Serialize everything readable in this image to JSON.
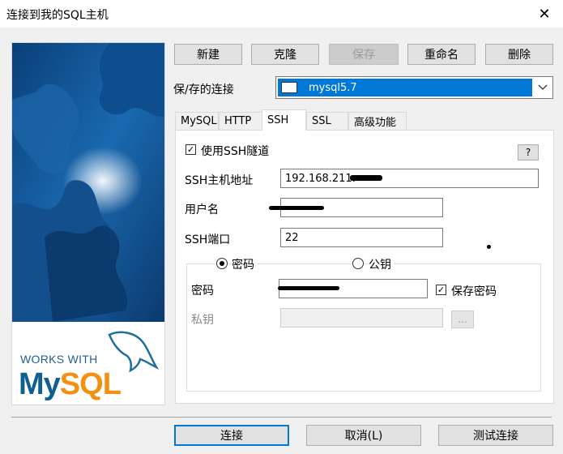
{
  "window": {
    "title": "连接到我的SQL主机"
  },
  "branding": {
    "works_with": "WORKS WITH",
    "logo_my": "My",
    "logo_sql": "SQL"
  },
  "toolbar": {
    "new_label": "新建",
    "clone_label": "克隆",
    "save_label": "保存",
    "rename_label": "重命名",
    "delete_label": "删除"
  },
  "saved_connections": {
    "label": "保/存的连接",
    "selected": "mysql5.7"
  },
  "tabs": [
    {
      "label": "MySQL"
    },
    {
      "label": "HTTP"
    },
    {
      "label": "SSH"
    },
    {
      "label": "SSL"
    },
    {
      "label": "高级功能"
    }
  ],
  "ssh": {
    "use_tunnel_label": "使用SSH隧道",
    "use_tunnel_checked": true,
    "help_label": "?",
    "host_label": "SSH主机地址",
    "host_value": "192.168.211.",
    "username_label": "用户名",
    "port_label": "SSH端口",
    "port_value": "22",
    "auth_password_label": "密码",
    "auth_pubkey_label": "公钥",
    "password_label": "密码",
    "save_password_label": "保存密码",
    "save_password_checked": true,
    "private_key_label": "私钥",
    "browse_label": "..."
  },
  "footer": {
    "connect_label": "连接",
    "cancel_label": "取消(L)",
    "test_label": "测试连接"
  }
}
